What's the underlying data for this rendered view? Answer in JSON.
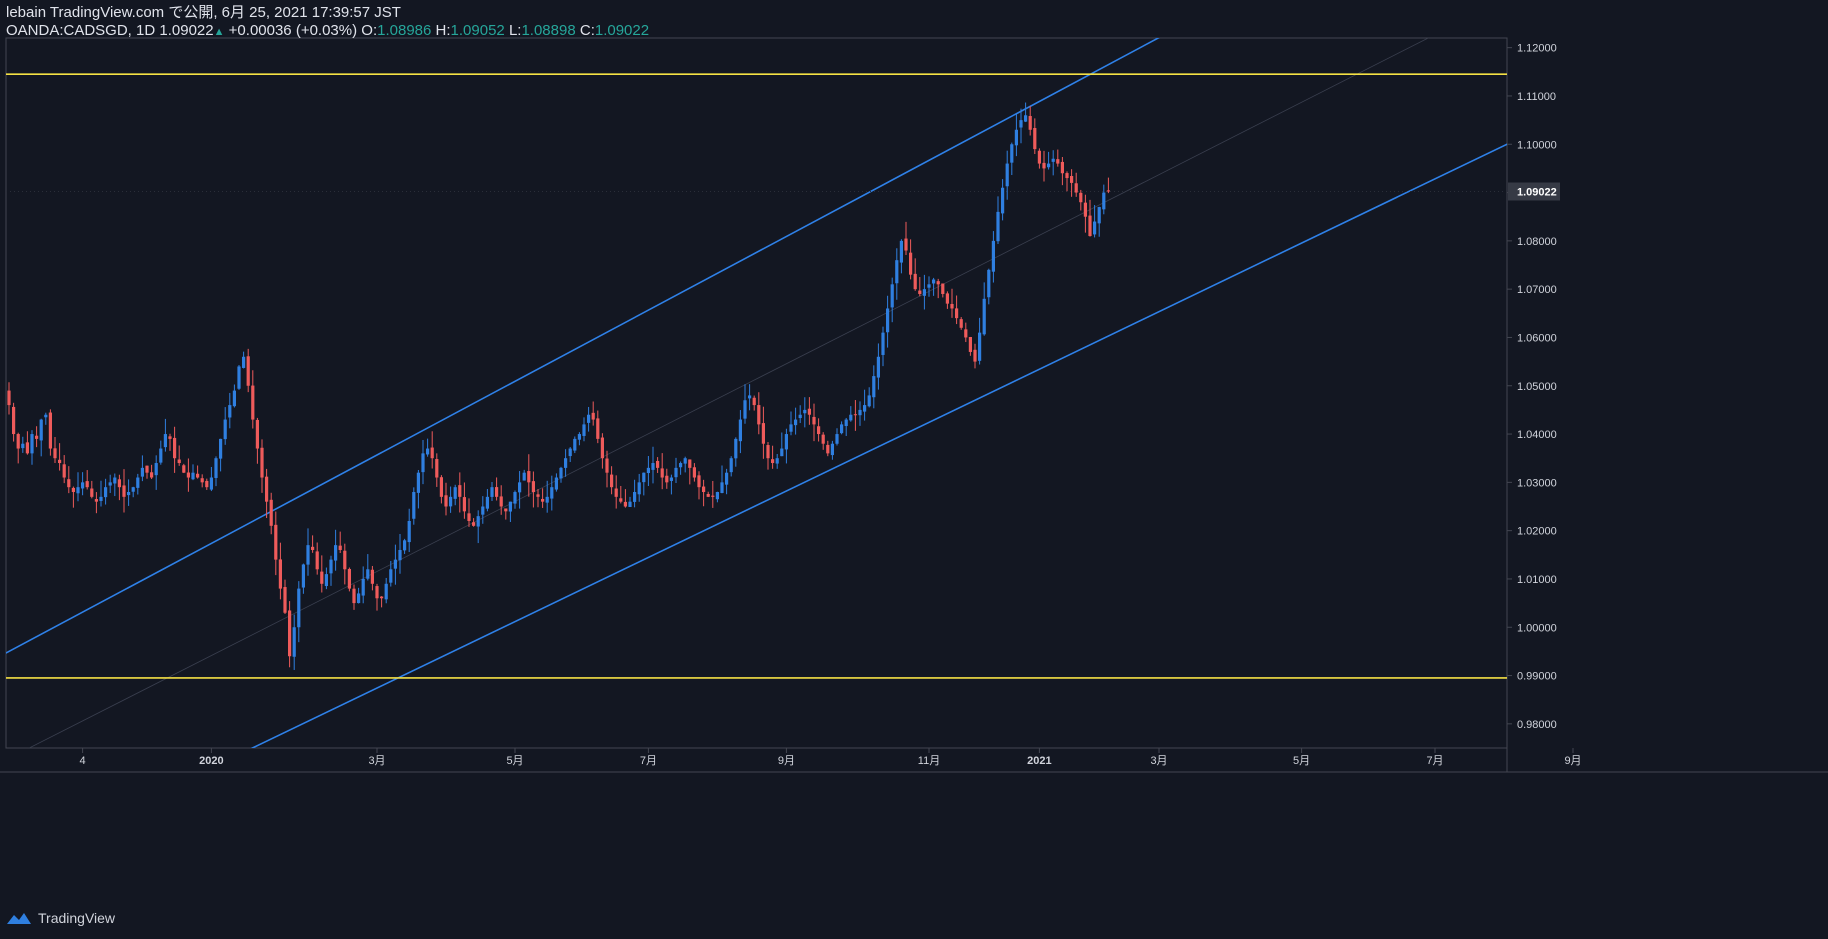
{
  "header": {
    "line1": "lebain TradingView.com で公開, 6月 25, 2021 17:39:57 JST",
    "symbol": "OANDA:CADSGD, 1D",
    "last": "1.09022",
    "change": "+0.00036 (+0.03%)",
    "o_label": "O:",
    "o": "1.08986",
    "h_label": "H:",
    "h": "1.09052",
    "l_label": "L:",
    "l": "1.08898",
    "c_label": "C:",
    "c": "1.09022"
  },
  "footer": {
    "brand": "TradingView"
  },
  "colors": {
    "background": "#131722",
    "bull": "#2f7fe0",
    "bear": "#ef5b5b",
    "channel": "#2f81e8",
    "horizontal": "#f5e144",
    "grid_border": "#434651",
    "axis_text": "#d1d4dc"
  },
  "chart_data": {
    "type": "candlestick",
    "symbol": "OANDA:CADSGD",
    "interval": "1D",
    "ylim": [
      0.975,
      1.122
    ],
    "y_ticks": [
      "0.98000",
      "0.99000",
      "1.00000",
      "1.01000",
      "1.02000",
      "1.03000",
      "1.04000",
      "1.05000",
      "1.06000",
      "1.07000",
      "1.08000",
      "1.09000",
      "1.10000",
      "1.11000",
      "1.12000"
    ],
    "last_price_label": "1.09022",
    "x_ticks": [
      "4",
      "2020",
      "3月",
      "5月",
      "7月",
      "9月",
      "11月",
      "2021",
      "3月",
      "5月",
      "7月",
      "9月"
    ],
    "closes": [
      1.046,
      1.04,
      1.037,
      1.038,
      1.036,
      1.04,
      1.039,
      1.043,
      1.044,
      1.037,
      1.035,
      1.034,
      1.031,
      1.029,
      1.028,
      1.029,
      1.03,
      1.029,
      1.027,
      1.026,
      1.027,
      1.029,
      1.03,
      1.031,
      1.029,
      1.027,
      1.028,
      1.029,
      1.031,
      1.033,
      1.032,
      1.031,
      1.034,
      1.037,
      1.04,
      1.039,
      1.035,
      1.034,
      1.032,
      1.031,
      1.032,
      1.031,
      1.03,
      1.029,
      1.031,
      1.035,
      1.039,
      1.043,
      1.046,
      1.049,
      1.054,
      1.056,
      1.05,
      1.043,
      1.037,
      1.031,
      1.026,
      1.021,
      1.014,
      1.008,
      1.003,
      0.994,
      1.0,
      1.008,
      1.013,
      1.017,
      1.016,
      1.012,
      1.009,
      1.011,
      1.014,
      1.017,
      1.016,
      1.012,
      1.008,
      1.005,
      1.007,
      1.01,
      1.012,
      1.009,
      1.006,
      1.006,
      1.009,
      1.012,
      1.014,
      1.016,
      1.018,
      1.022,
      1.028,
      1.032,
      1.036,
      1.037,
      1.035,
      1.031,
      1.027,
      1.025,
      1.027,
      1.029,
      1.027,
      1.024,
      1.022,
      1.021,
      1.023,
      1.025,
      1.027,
      1.029,
      1.027,
      1.025,
      1.024,
      1.026,
      1.028,
      1.03,
      1.032,
      1.03,
      1.028,
      1.027,
      1.026,
      1.027,
      1.029,
      1.031,
      1.033,
      1.035,
      1.037,
      1.039,
      1.04,
      1.042,
      1.044,
      1.043,
      1.039,
      1.035,
      1.032,
      1.029,
      1.027,
      1.026,
      1.025,
      1.026,
      1.028,
      1.03,
      1.032,
      1.033,
      1.034,
      1.033,
      1.031,
      1.03,
      1.031,
      1.033,
      1.034,
      1.035,
      1.033,
      1.031,
      1.029,
      1.028,
      1.027,
      1.027,
      1.028,
      1.03,
      1.032,
      1.035,
      1.039,
      1.043,
      1.047,
      1.048,
      1.046,
      1.042,
      1.038,
      1.035,
      1.034,
      1.035,
      1.037,
      1.04,
      1.042,
      1.043,
      1.044,
      1.045,
      1.044,
      1.042,
      1.04,
      1.038,
      1.036,
      1.038,
      1.04,
      1.042,
      1.043,
      1.044,
      1.044,
      1.045,
      1.046,
      1.048,
      1.052,
      1.056,
      1.061,
      1.066,
      1.071,
      1.076,
      1.08,
      1.078,
      1.073,
      1.07,
      1.069,
      1.07,
      1.071,
      1.072,
      1.071,
      1.069,
      1.067,
      1.066,
      1.064,
      1.062,
      1.06,
      1.057,
      1.055,
      1.061,
      1.068,
      1.074,
      1.08,
      1.086,
      1.091,
      1.096,
      1.1,
      1.103,
      1.105,
      1.106,
      1.103,
      1.099,
      1.096,
      1.095,
      1.096,
      1.097,
      1.096,
      1.094,
      1.093,
      1.092,
      1.09,
      1.088,
      1.085,
      1.081,
      1.084,
      1.087,
      1.09,
      1.09022
    ],
    "overlays": {
      "horizontal_lines": [
        1.1145,
        0.9895
      ],
      "channel_upper": [
        [
          0,
          0.995
        ],
        [
          240,
          1.117
        ]
      ],
      "channel_lower": [
        [
          54,
          0.9755
        ],
        [
          282,
          1.08
        ]
      ]
    }
  }
}
